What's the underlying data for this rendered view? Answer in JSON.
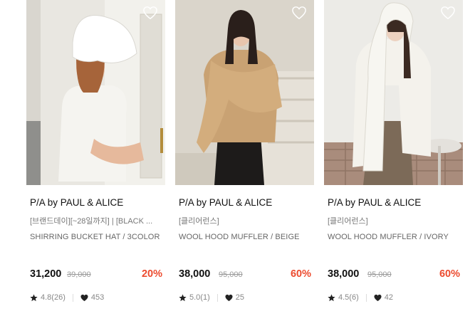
{
  "products": [
    {
      "brand": "P/A by PAUL & ALICE",
      "promo": "[브랜드데이][~28일까지] | [BLACK ...",
      "name": "SHIRRING BUCKET HAT / 3COLOR",
      "price": "31,200",
      "original_price": "39,000",
      "discount": "20%",
      "rating": "4.8(26)",
      "likes": "453"
    },
    {
      "brand": "P/A by PAUL & ALICE",
      "promo": "[클리어런스]",
      "name": "WOOL HOOD MUFFLER / BEIGE",
      "price": "38,000",
      "original_price": "95,000",
      "discount": "60%",
      "rating": "5.0(1)",
      "likes": "25"
    },
    {
      "brand": "P/A by PAUL & ALICE",
      "promo": "[클리어런스]",
      "name": "WOOL HOOD MUFFLER / IVORY",
      "price": "38,000",
      "original_price": "95,000",
      "discount": "60%",
      "rating": "4.5(6)",
      "likes": "42"
    }
  ],
  "icons": {
    "wishlist": "heart-outline-icon",
    "rating": "star-icon",
    "likes": "heart-filled-icon"
  },
  "colors": {
    "discount": "#ec4b2f"
  }
}
